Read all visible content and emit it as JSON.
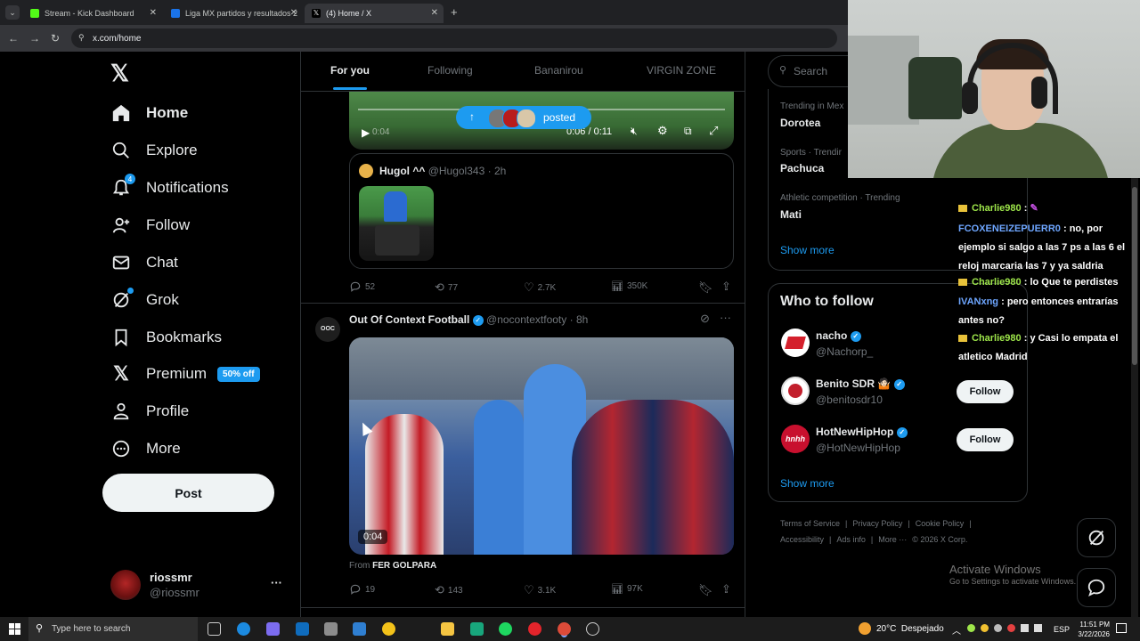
{
  "browser": {
    "tabs": [
      {
        "title": "Stream - Kick Dashboard",
        "color": "#53fc18"
      },
      {
        "title": "Liga MX partidos y resultados 2",
        "color": "#1a73e8"
      },
      {
        "title": "(4) Home / X",
        "color": "#000000"
      }
    ],
    "url": "x.com/home"
  },
  "nav": {
    "items": [
      {
        "label": "Home",
        "icon": "home-icon"
      },
      {
        "label": "Explore",
        "icon": "search-icon"
      },
      {
        "label": "Notifications",
        "icon": "bell-icon",
        "badge": "4"
      },
      {
        "label": "Follow",
        "icon": "add-person-icon"
      },
      {
        "label": "Chat",
        "icon": "mail-icon"
      },
      {
        "label": "Grok",
        "icon": "grok-icon"
      },
      {
        "label": "Bookmarks",
        "icon": "bookmark-icon"
      },
      {
        "label": "Premium",
        "icon": "x-logo-icon",
        "promo": "50% off"
      },
      {
        "label": "Profile",
        "icon": "person-icon"
      },
      {
        "label": "More",
        "icon": "more-circle-icon"
      }
    ],
    "post_label": "Post",
    "account": {
      "name": "riossmr",
      "handle": "@riossmr",
      "menu": "···"
    }
  },
  "feed": {
    "tabs": [
      "For you",
      "Following",
      "Bananirou",
      "VIRGIN ZONE"
    ],
    "posted_pill": "posted",
    "video1": {
      "time": "0:06 / 0:11",
      "faded": "0:04"
    },
    "quoted": {
      "name": "Hugol ^^",
      "handle": "@Hugol343",
      "time": "2h"
    },
    "post1_stats": {
      "replies": "52",
      "reposts": "77",
      "likes": "2.7K",
      "views": "350K"
    },
    "post2": {
      "name": "Out Of Context Football",
      "handle": "@nocontextfooty",
      "time": "8h",
      "video_time": "0:04",
      "from_label": "From",
      "from_name": "FER GOLPARA",
      "stats": {
        "replies": "19",
        "reposts": "143",
        "likes": "3.1K",
        "views": "97K"
      }
    }
  },
  "right": {
    "search_placeholder": "Search",
    "trends": [
      {
        "meta": "Trending in Mex",
        "name": "Dorotea"
      },
      {
        "meta": "Sports · Trendir",
        "name": "Pachuca"
      },
      {
        "meta": "Athletic competition · Trending",
        "name": "Mati"
      }
    ],
    "show_more": "Show more",
    "who_to_follow": {
      "title": "Who to follow",
      "accounts": [
        {
          "name": "nacho",
          "handle": "@Nachorp_"
        },
        {
          "name": "Benito SDR 🤷🏻",
          "handle": "@benitosdr10",
          "button": "Follow"
        },
        {
          "name": "HotNewHipHop",
          "handle": "@HotNewHipHop",
          "button": "Follow"
        }
      ],
      "show_more": "Show more"
    },
    "footer": {
      "row1": [
        "Terms of Service",
        "|",
        "Privacy Policy",
        "|",
        "Cookie Policy",
        "|"
      ],
      "row2": [
        "Accessibility",
        "|",
        "Ads info",
        "|",
        "More ···",
        "© 2026 X Corp."
      ]
    }
  },
  "chat": [
    {
      "user": "Charlie980",
      "text": ":"
    },
    {
      "user": "FCOXENEIZEPUERR0",
      "text": ": no, por ejemplo si salgo a las 7 ps a las 6 el reloj marcaria las 7 y ya saldria"
    },
    {
      "user": "Charlie980",
      "text": ": lo Que te perdistes"
    },
    {
      "user": "IVANxng",
      "text": ": pero entonces entrarías antes no?"
    },
    {
      "user": "Charlie980",
      "text": ": y Casi lo empata el atletico Madrid"
    }
  ],
  "windows": {
    "activate_title": "Activate Windows",
    "activate_sub": "Go to Settings to activate Windows.",
    "search_placeholder": "Type here to search",
    "weather": "20°C  Despejado",
    "lang": "ESP",
    "time": "11:51 PM",
    "date": "3/22/2026"
  },
  "colors": {
    "accent": "#1d9bf0",
    "bg": "#000000",
    "border": "#2f3336",
    "muted": "#71767b"
  }
}
